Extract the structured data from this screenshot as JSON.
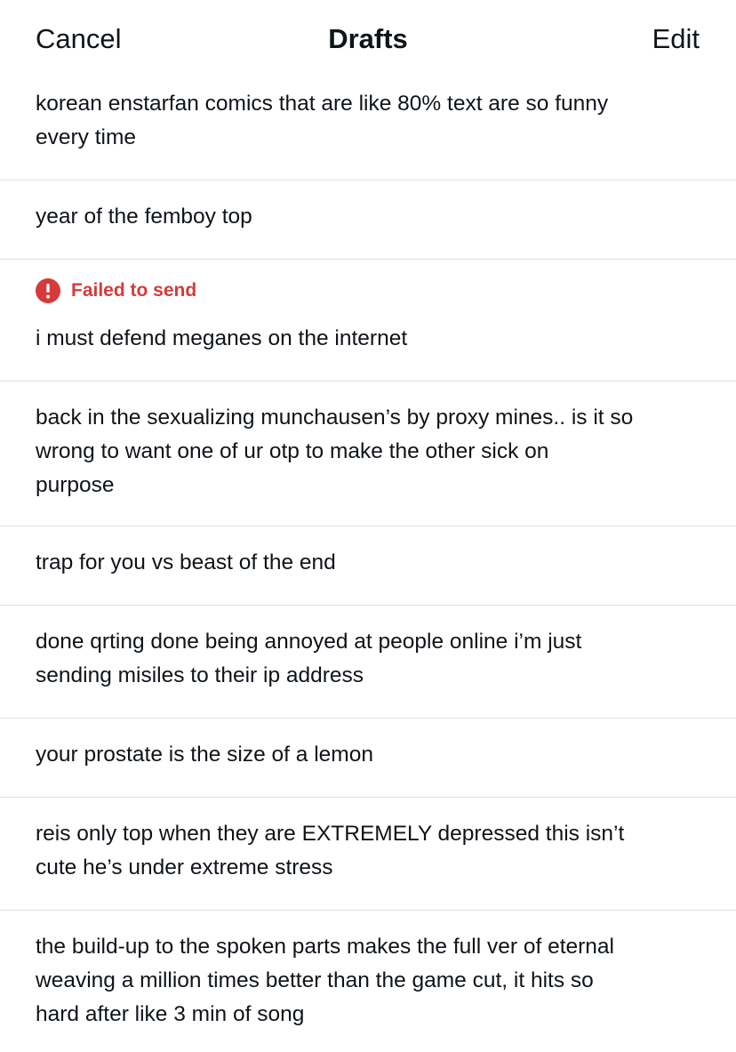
{
  "header": {
    "cancel_label": "Cancel",
    "title": "Drafts",
    "edit_label": "Edit"
  },
  "drafts": [
    {
      "text": "korean enstarfan comics that are like 80% text are so funny\nevery time"
    },
    {
      "text": "year of the femboy top"
    },
    {
      "status": "Failed to send",
      "text": "i must defend meganes on the internet"
    },
    {
      "text": "back in the sexualizing munchausen’s by proxy mines.. is it so\nwrong to want one of ur otp to make the other sick on\npurpose"
    },
    {
      "text": "trap for you vs beast of the end"
    },
    {
      "text": "done qrting done being annoyed at people online i’m just\nsending misiles to their ip address"
    },
    {
      "text": "your prostate is the size of a lemon"
    },
    {
      "text": "reis only top when they are EXTREMELY depressed this isn’t\ncute he’s under extreme stress"
    },
    {
      "text": "the build-up to the spoken parts makes the full ver of eternal\nweaving a million times better than the game cut, it hits so\nhard after like 3 min of song"
    }
  ],
  "colors": {
    "text": "#0f1419",
    "error": "#d63a3a",
    "divider": "#dcdfe2"
  },
  "icons": {
    "failed_status": "exclamation-circle-icon"
  }
}
